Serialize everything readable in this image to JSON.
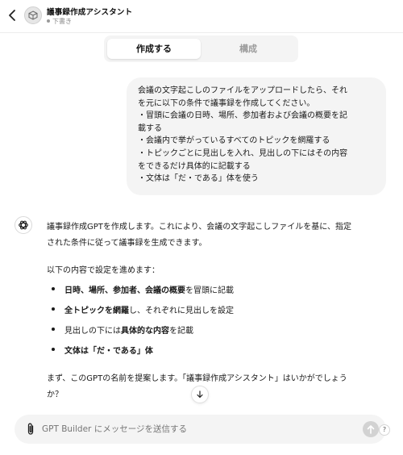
{
  "header": {
    "title": "議事録作成アシスタント",
    "status": "下書き"
  },
  "tabs": [
    {
      "label": "作成する",
      "active": true
    },
    {
      "label": "構成",
      "active": false
    }
  ],
  "user_message": {
    "lines": [
      "会議の文字起こしのファイルをアップロードしたら、それ",
      "を元に以下の条件で議事録を作成してください。",
      "・冒頭に会議の日時、場所、参加者および会議の概要を記",
      "載する",
      "・会議内で挙がっているすべてのトピックを網羅する",
      "・トピックごとに見出しを入れ、見出しの下にはその内容",
      "をできるだけ具体的に記載する",
      "・文体は「だ・である」体を使う"
    ]
  },
  "assistant_message": {
    "intro_lines": [
      "議事録作成GPTを作成します。これにより、会議の文字起こしファイルを基に、指定",
      "された条件に従って議事録を生成できます。"
    ],
    "settings_intro": "以下の内容で設定を進めます：",
    "bullets": [
      {
        "bold_a": "日時、場所、参加者、会議の概要",
        "text_a": "を冒頭に記載",
        "bold_b": "",
        "text_b": ""
      },
      {
        "bold_a": "全トピックを網羅",
        "text_a": "し、それぞれに見出しを設定",
        "bold_b": "",
        "text_b": ""
      },
      {
        "bold_a": "",
        "text_a": "見出しの下には",
        "bold_b": "具体的な内容",
        "text_b": "を記載"
      },
      {
        "bold_a": "文体は「だ・である」体",
        "text_a": "",
        "bold_b": "",
        "text_b": ""
      }
    ],
    "closing_lines": [
      "まず、このGPTの名前を提案します。「議事録作成アシスタント」はいかがでしょう",
      "か？"
    ]
  },
  "composer": {
    "placeholder": "GPT Builder にメッセージを送信する"
  },
  "help_label": "?",
  "colors": {
    "bubble": "#f4f4f4",
    "send_disabled": "#d2d2d2",
    "muted": "#8a8a8a"
  }
}
